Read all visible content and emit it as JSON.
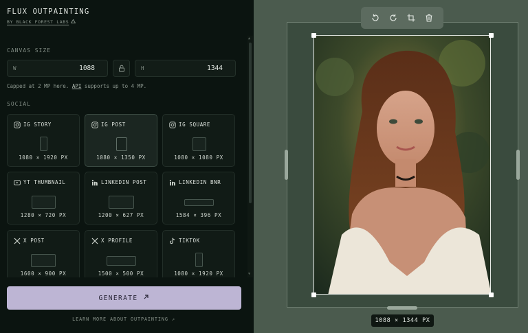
{
  "app": {
    "title": "FLUX OUTPAINTING",
    "byline": "BY BLACK FOREST LABS"
  },
  "canvas_size": {
    "section_label": "CANVAS SIZE",
    "width_label": "W",
    "width_value": "1088",
    "height_label": "H",
    "height_value": "1344",
    "note_prefix": "Capped at 2 MP here. ",
    "note_api": "API",
    "note_suffix": " supports up to 4 MP."
  },
  "social": {
    "section_label": "SOCIAL",
    "presets": [
      {
        "name": "IG STORY",
        "size": "1080 × 1920 PX",
        "icon": "instagram-icon"
      },
      {
        "name": "IG POST",
        "size": "1080 × 1350 PX",
        "icon": "instagram-icon"
      },
      {
        "name": "IG SQUARE",
        "size": "1080 × 1080 PX",
        "icon": "instagram-icon"
      },
      {
        "name": "YT THUMBNAIL",
        "size": "1280 × 720 PX",
        "icon": "youtube-icon"
      },
      {
        "name": "LINKEDIN POST",
        "size": "1200 × 627 PX",
        "icon": "linkedin-icon"
      },
      {
        "name": "LINKEDIN BNR",
        "size": "1584 × 396 PX",
        "icon": "linkedin-icon"
      },
      {
        "name": "X POST",
        "size": "1600 × 900 PX",
        "icon": "x-icon"
      },
      {
        "name": "X PROFILE",
        "size": "1500 × 500 PX",
        "icon": "x-icon"
      },
      {
        "name": "TIKTOK",
        "size": "1080 × 1920 PX",
        "icon": "tiktok-icon"
      }
    ],
    "selected": "IG POST"
  },
  "actions": {
    "generate_label": "GENERATE",
    "learn_more": "LEARN MORE ABOUT OUTPAINTING ↗"
  },
  "canvas": {
    "size_readout": "1088 × 1344 PX",
    "tools": [
      "undo-icon",
      "redo-icon",
      "crop-icon",
      "trash-icon"
    ]
  },
  "colors": {
    "panel_bg": "#0b1410",
    "canvas_bg": "#4b5b4e",
    "generate_bg": "#bdb5d4"
  }
}
